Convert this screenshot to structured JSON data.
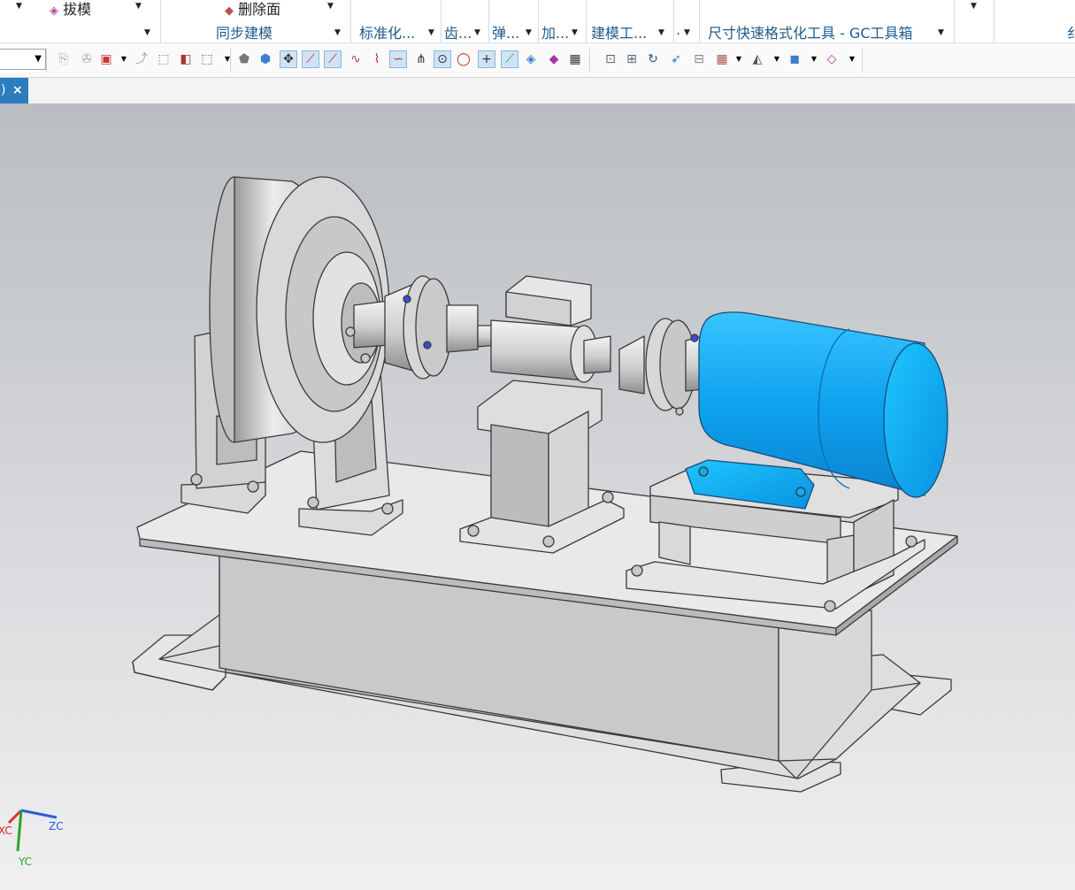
{
  "ribbon": {
    "draft_label": "拔模",
    "delete_face_label": "删除面",
    "groups": [
      {
        "label": "同步建模"
      },
      {
        "label": "标准化..."
      },
      {
        "label": "齿..."
      },
      {
        "label": "弹..."
      },
      {
        "label": "加..."
      },
      {
        "label": "建模工..."
      },
      {
        "label": "."
      },
      {
        "label": "尺寸快速格式化工具 - GC工具箱"
      }
    ],
    "cut_right_label": "纟"
  },
  "toolbar": {
    "icons": [
      "replace-view-icon",
      "show-hide-icon",
      "select-filter-icon",
      "snap-icon",
      "point-snap-icon",
      "face-select-icon",
      "rectangle-select-icon",
      "solid-body-icon",
      "cube-icon",
      "control-point-icon",
      "end-point-icon",
      "mid-point-icon",
      "curve-icon",
      "point-on-curve-icon",
      "spline-icon",
      "intersection-icon",
      "arc-center-icon",
      "quadrant-icon",
      "cross-point-icon",
      "tangent-icon",
      "view-triad-icon",
      "render-style-icon",
      "sheet-icon",
      "fit-view-icon",
      "zoom-icon",
      "rotate-icon",
      "pan-icon",
      "hide-icon",
      "layer-icon",
      "shading-icon",
      "orient-icon",
      "section-icon"
    ]
  },
  "tab": {
    "partial_label": ")",
    "close_label": "×"
  },
  "viewport": {
    "triad": {
      "x_label": "XC",
      "y_label": "YC",
      "z_label": "ZC"
    },
    "colors": {
      "motor": "#0a9ee8",
      "motor_base": "#1aa8f0",
      "part": "#e2e2e2",
      "edge": "#3a3a3a"
    }
  }
}
